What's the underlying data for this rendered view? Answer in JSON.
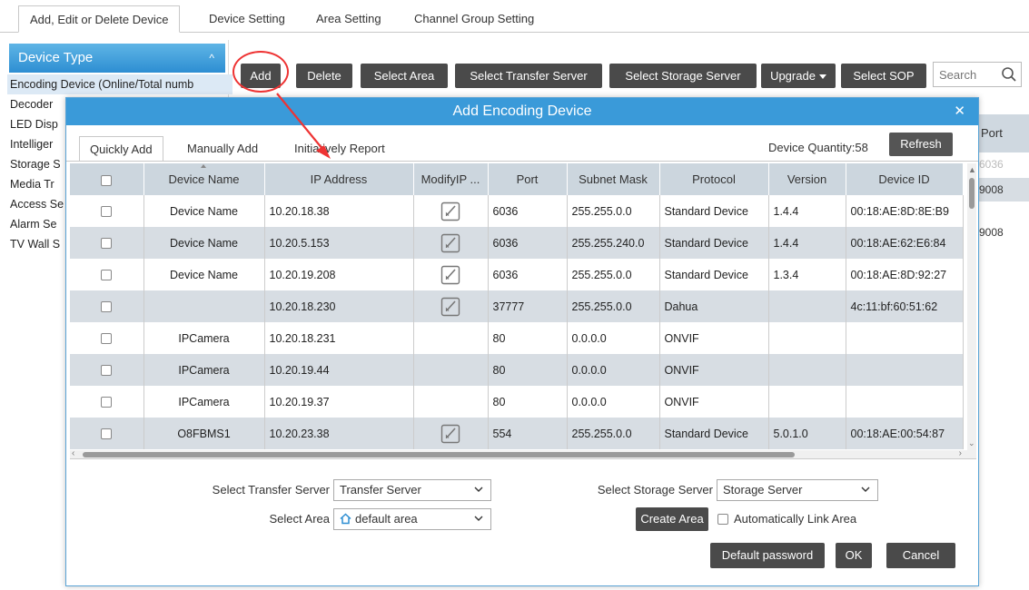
{
  "top_tabs": [
    "Add, Edit or Delete Device",
    "Device Setting",
    "Area Setting",
    "Channel Group Setting"
  ],
  "left_panel": {
    "header": "Device Type",
    "items": [
      "Encoding Device (Online/Total numb",
      "Decoder",
      "LED Disp",
      "Intelliger",
      "Storage S",
      "Media Tr",
      "Access Se",
      "Alarm Se",
      "TV Wall S"
    ]
  },
  "toolbar": {
    "add": "Add",
    "delete": "Delete",
    "select_area": "Select Area",
    "select_transfer_server": "Select Transfer Server",
    "select_storage_server": "Select Storage Server",
    "upgrade": "Upgrade",
    "select_sop": "Select SOP",
    "search_placeholder": "Search"
  },
  "background_table": {
    "port_header": "Port",
    "port_values": [
      "6036",
      "9008",
      "9008"
    ]
  },
  "dialog": {
    "title": "Add Encoding Device",
    "tabs": [
      "Quickly Add",
      "Manually Add",
      "Initiatively Report"
    ],
    "device_quantity": "Device Quantity:58",
    "refresh": "Refresh",
    "columns": [
      "Device Name",
      "IP Address",
      "ModifyIP ...",
      "Port",
      "Subnet Mask",
      "Protocol",
      "Version",
      "Device ID"
    ],
    "rows": [
      {
        "name": "Device Name",
        "ip": "10.20.18.38",
        "editable": true,
        "port": "6036",
        "mask": "255.255.0.0",
        "protocol": "Standard Device",
        "version": "1.4.4",
        "device_id": "00:18:AE:8D:8E:B9"
      },
      {
        "name": "Device Name",
        "ip": "10.20.5.153",
        "editable": true,
        "port": "6036",
        "mask": "255.255.240.0",
        "protocol": "Standard Device",
        "version": "1.4.4",
        "device_id": "00:18:AE:62:E6:84"
      },
      {
        "name": "Device Name",
        "ip": "10.20.19.208",
        "editable": true,
        "port": "6036",
        "mask": "255.255.0.0",
        "protocol": "Standard Device",
        "version": "1.3.4",
        "device_id": "00:18:AE:8D:92:27"
      },
      {
        "name": "",
        "ip": "10.20.18.230",
        "editable": true,
        "port": "37777",
        "mask": "255.255.0.0",
        "protocol": "Dahua",
        "version": "",
        "device_id": "4c:11:bf:60:51:62"
      },
      {
        "name": "IPCamera",
        "ip": "10.20.18.231",
        "editable": false,
        "port": "80",
        "mask": "0.0.0.0",
        "protocol": "ONVIF",
        "version": "",
        "device_id": ""
      },
      {
        "name": "IPCamera",
        "ip": "10.20.19.44",
        "editable": false,
        "port": "80",
        "mask": "0.0.0.0",
        "protocol": "ONVIF",
        "version": "",
        "device_id": ""
      },
      {
        "name": "IPCamera",
        "ip": "10.20.19.37",
        "editable": false,
        "port": "80",
        "mask": "0.0.0.0",
        "protocol": "ONVIF",
        "version": "",
        "device_id": ""
      },
      {
        "name": "O8FBMS1",
        "ip": "10.20.23.38",
        "editable": true,
        "port": "554",
        "mask": "255.255.0.0",
        "protocol": "Standard Device",
        "version": "5.0.1.0",
        "device_id": "00:18:AE:00:54:87"
      }
    ],
    "form": {
      "transfer_label": "Select Transfer Server",
      "transfer_value": "Transfer Server",
      "storage_label": "Select Storage Server",
      "storage_value": "Storage Server",
      "area_label": "Select Area",
      "area_value": "default area",
      "create_area": "Create Area",
      "auto_link": "Automatically Link Area"
    },
    "buttons": {
      "default_password": "Default password",
      "ok": "OK",
      "cancel": "Cancel"
    }
  },
  "colors": {
    "title_blue": "#3a9ad9",
    "button_dark": "#4a4a4a",
    "header_gray": "#ccd6de",
    "annotation_red": "#e33333"
  }
}
